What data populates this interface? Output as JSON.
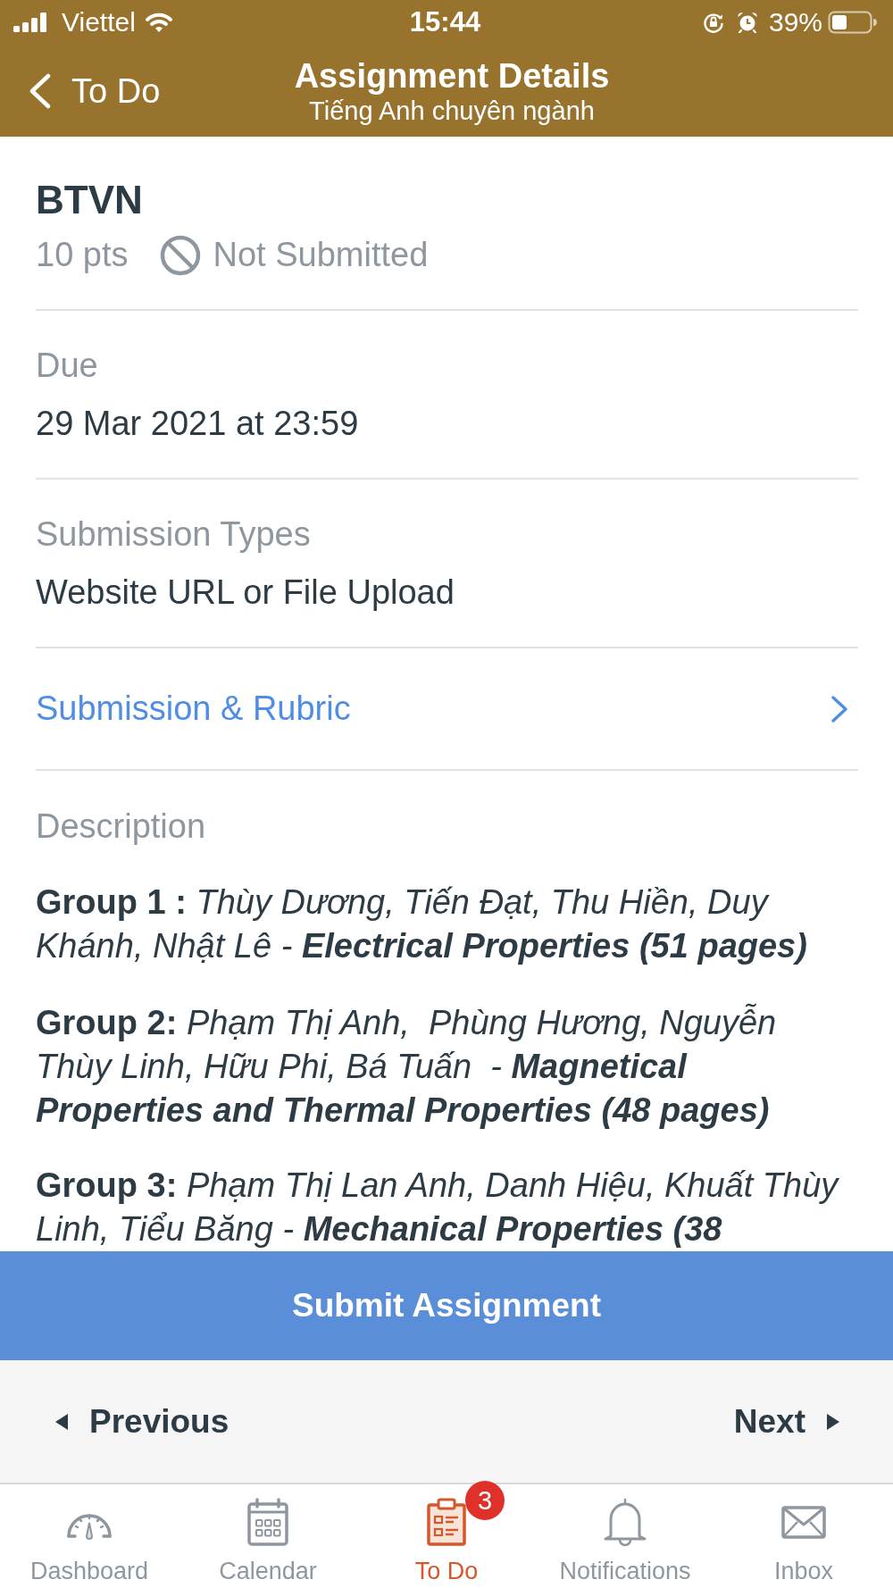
{
  "status_bar": {
    "carrier": "Viettel",
    "time": "15:44",
    "battery": "39%"
  },
  "nav_bar": {
    "back_label": "To Do",
    "title": "Assignment Details",
    "subtitle": "Tiếng Anh chuyên ngành"
  },
  "assignment": {
    "name": "BTVN",
    "points": "10 pts",
    "submission_status": "Not Submitted"
  },
  "details": [
    {
      "label": "Due",
      "value": "29 Mar 2021 at 23:59"
    },
    {
      "label": "Submission Types",
      "value": "Website URL or File Upload"
    }
  ],
  "link": {
    "label": "Submission & Rubric"
  },
  "description": {
    "label": "Description",
    "groups": [
      {
        "label": "Group 1 :",
        "members": "Thùy Dương, Tiến Đạt, Thu Hiền, Duy Khánh, Nhật Lê -",
        "topic": "Electrical Properties (51 pages)"
      },
      {
        "label": "Group 2:",
        "members": "Phạm Thị Anh,  Phùng Hương, Nguyễn Thùy Linh, Hữu Phi, Bá Tuấn  -",
        "topic": "Magnetical Properties and Thermal Properties (48 pages)"
      },
      {
        "label": "Group 3:",
        "members": "Phạm Thị Lan Anh, Danh Hiệu, Khuất Thùy Linh, Tiểu Băng -",
        "topic": "Mechanical Properties (38"
      }
    ]
  },
  "submit_button": "Submit Assignment",
  "pager": {
    "previous": "Previous",
    "next": "Next"
  },
  "tab_bar": [
    {
      "kind": "dashboard",
      "label": "Dashboard",
      "selected": false
    },
    {
      "kind": "calendar",
      "label": "Calendar",
      "selected": false
    },
    {
      "kind": "todo",
      "label": "To Do",
      "selected": true,
      "badge": "3"
    },
    {
      "kind": "notifications",
      "label": "Notifications",
      "selected": false
    },
    {
      "kind": "inbox",
      "label": "Inbox",
      "selected": false
    }
  ]
}
